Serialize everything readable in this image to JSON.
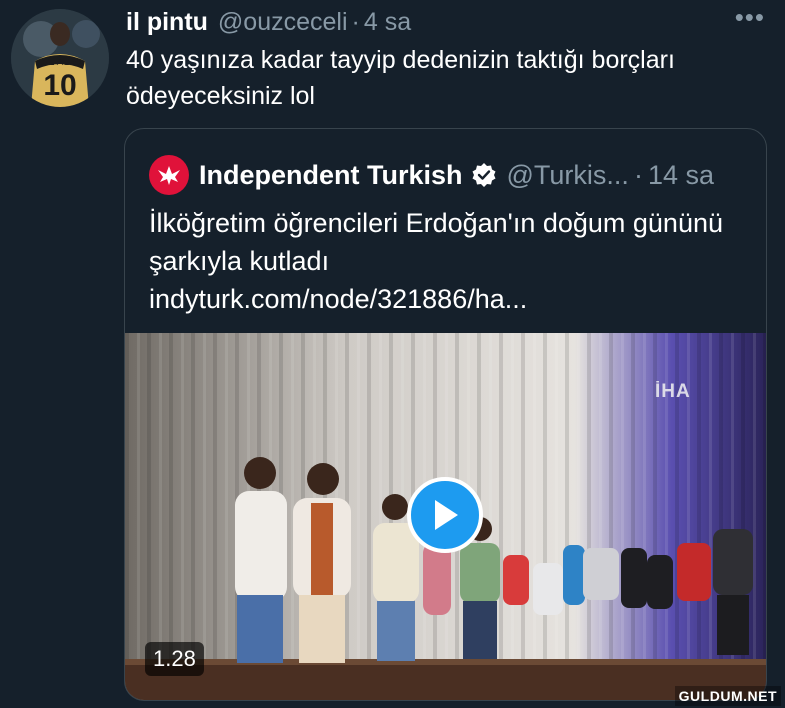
{
  "tweet": {
    "name": "il pintu",
    "handle": "@ouzceceli",
    "separator": "·",
    "time": "4 sa",
    "more": "•••",
    "text": "40 yaşınıza kadar tayyip dedenizin taktığı borçları ödeyeceksiniz lol"
  },
  "quote": {
    "name": "Independent Turkish",
    "handle": "@Turkis...",
    "separator": "·",
    "time": "14 sa",
    "text": "İlköğretim öğrencileri Erdoğan'ın doğum gününü şarkıyla kutladı",
    "link": "indyturk.com/node/321886/ha...",
    "media": {
      "channel_logo_text": "İHA",
      "duration": "1.28",
      "play_icon": "play-icon"
    }
  },
  "watermark": "GULDUM.NET",
  "colors": {
    "background": "#15202b",
    "secondary_text": "#8899a6",
    "border": "#38444d",
    "accent": "#1d9bf0",
    "brand_red": "#e0123a"
  }
}
